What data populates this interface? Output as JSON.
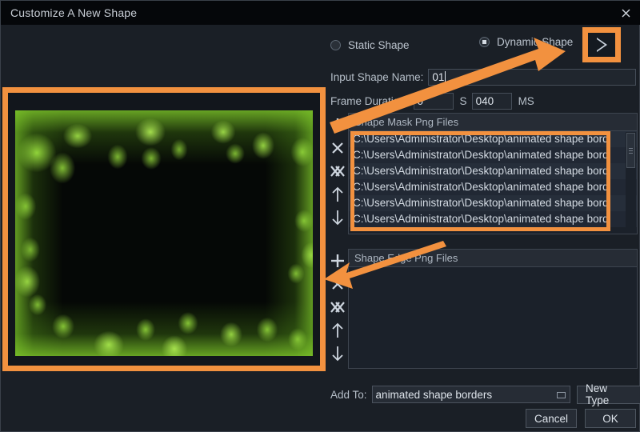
{
  "window": {
    "title": "Customize A New Shape",
    "close_icon": "close-icon"
  },
  "accent_color": "#f2913f",
  "shape_type": {
    "static_label": "Static Shape",
    "dynamic_label": "Dynamic Shape",
    "selected": "Dynamic Shape",
    "play_icon": "play-icon"
  },
  "fields": {
    "name_label": "Input Shape Name:",
    "name_value": "01",
    "duration_label": "Frame Duration:",
    "duration_seconds": "0",
    "seconds_unit": "S",
    "duration_ms": "040",
    "ms_unit": "MS"
  },
  "toolbar_icons": {
    "add": "plus-icon",
    "remove": "x-icon",
    "remove_all": "double-x-icon",
    "move_up": "arrow-up-icon",
    "move_down": "arrow-down-icon"
  },
  "mask_list": {
    "header": "Shape Mask Png Files",
    "rows": [
      "C:\\Users\\Administrator\\Desktop\\animated shape bord",
      "C:\\Users\\Administrator\\Desktop\\animated shape bord",
      "C:\\Users\\Administrator\\Desktop\\animated shape bord",
      "C:\\Users\\Administrator\\Desktop\\animated shape bord",
      "C:\\Users\\Administrator\\Desktop\\animated shape bord",
      "C:\\Users\\Administrator\\Desktop\\animated shape bord"
    ]
  },
  "edge_list": {
    "header": "Shape Edge Png Files",
    "rows": []
  },
  "bottom": {
    "add_to_label": "Add To:",
    "add_to_value": "animated shape borders",
    "new_type_label": "New Type",
    "cancel_label": "Cancel",
    "ok_label": "OK"
  }
}
